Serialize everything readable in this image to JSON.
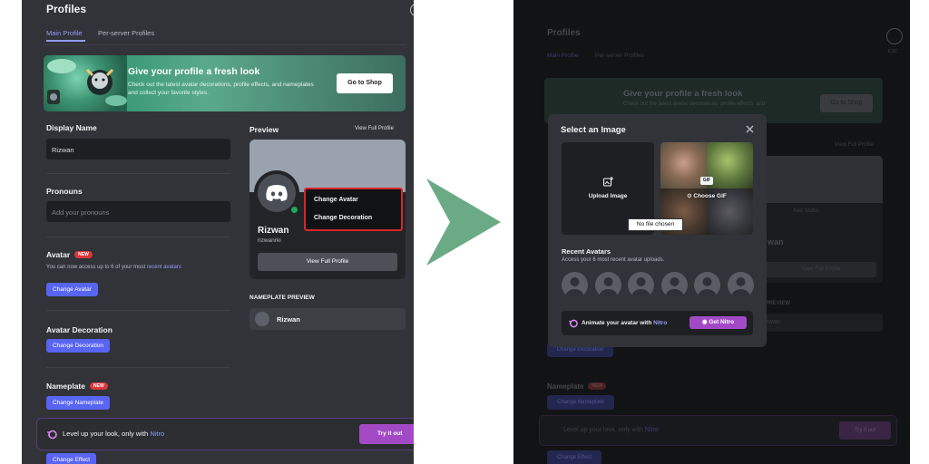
{
  "left": {
    "title": "Profiles",
    "tabs": [
      "Main Profile",
      "Per-server Profiles"
    ],
    "banner": {
      "title": "Give your profile a fresh look",
      "text": "Check out the latest avatar decorations, profile effects, and nameplates and collect your favorite styles.",
      "button": "Go to Shop"
    },
    "display_name": {
      "label": "Display Name",
      "value": "Rizwan"
    },
    "pronouns": {
      "label": "Pronouns",
      "placeholder": "Add your pronouns"
    },
    "avatar": {
      "label": "Avatar",
      "badge": "NEW",
      "hint": "You can now access up to 6 of your most",
      "hint_link": "recent avatars",
      "button": "Change Avatar"
    },
    "avatar_decoration": {
      "label": "Avatar Decoration",
      "button": "Change Decoration"
    },
    "nameplate": {
      "label": "Nameplate",
      "badge": "NEW",
      "button": "Change Nameplate"
    },
    "effect_button": "Change Effect",
    "preview": {
      "label": "Preview",
      "view_full_link": "View Full Profile",
      "name": "Rizwan",
      "username": "rizwanrki",
      "button": "View Full Profile",
      "menu": [
        "Change Avatar",
        "Change Decoration"
      ]
    },
    "nameplate_preview": {
      "label": "NAMEPLATE PREVIEW",
      "name": "Rizwan"
    },
    "nitro_bar": {
      "text": "Level up your look, only with",
      "brand": "Nitro",
      "button": "Try it out"
    }
  },
  "right": {
    "bg": {
      "title": "Profiles",
      "tabs": [
        "Main Profile",
        "Per-server Profiles"
      ],
      "esc": "ESC",
      "banner_title": "Give your profile a fresh look",
      "banner_text": "Check out the latest avatar decorations, profile effects, and",
      "shop": "Go to Shop",
      "view_full_link": "View Full Profile",
      "add_status": "Add Status",
      "name_partial": "wan",
      "view_full_button": "View Full Profile",
      "np_preview": "TE PREVIEW",
      "np_name": "izwan",
      "change_decoration": "Change Decoration",
      "nameplate_label": "Nameplate",
      "nameplate_badge": "NEW",
      "change_nameplate": "Change Nameplate",
      "nitro_text": "Level up your look, only with",
      "nitro_brand": "Nitro",
      "try": "Try it out",
      "change_effect": "Change Effect"
    },
    "modal": {
      "title": "Select an Image",
      "upload": "Upload Image",
      "gif_badge": "GIF",
      "choose_gif": "Choose GIF",
      "tooltip": "No file chosen",
      "recent_title": "Recent Avatars",
      "recent_sub": "Access your 6 most recent avatar uploads.",
      "nitro_text": "Animate your avatar with",
      "nitro_brand": "Nitro",
      "nitro_button": "Get Nitro"
    }
  },
  "colors": {
    "blurple": "#5865f2",
    "nitro": "#a24ac5",
    "arrow": "#6aab85",
    "highlight": "#d7262e"
  }
}
